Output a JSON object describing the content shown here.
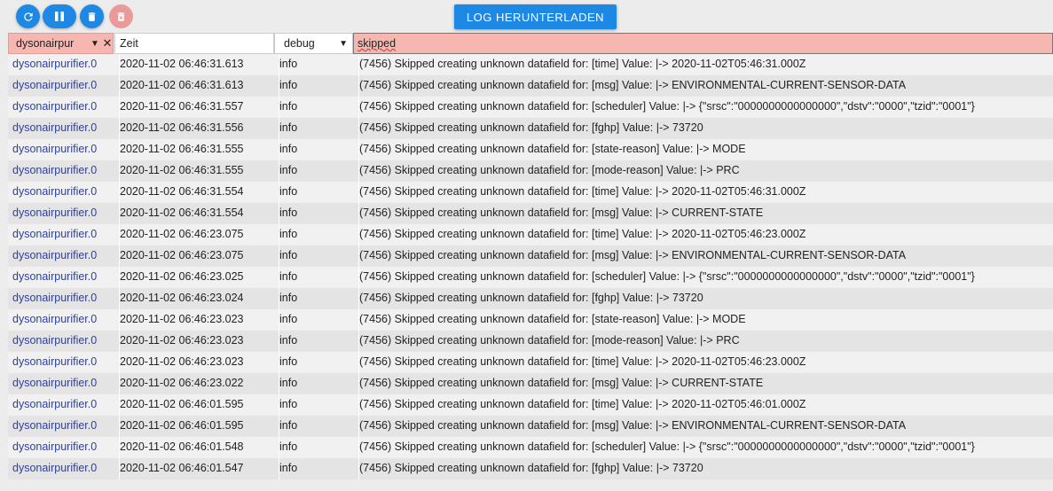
{
  "toolbar": {
    "download_label": "LOG HERUNTERLADEN",
    "buttons": [
      {
        "icon": "refresh-icon"
      },
      {
        "icon": "pause-icon"
      },
      {
        "icon": "trash-icon"
      },
      {
        "icon": "trash-x-icon",
        "disabled": true
      }
    ]
  },
  "filters": {
    "adapter_value": "dysonairpur",
    "time_placeholder": "Zeit",
    "level_value": "debug",
    "message_value": "skipped"
  },
  "rows": [
    {
      "source": "dysonairpurifier.0",
      "time": "2020-11-02 06:46:31.613",
      "level": "info",
      "message": "(7456) Skipped creating unknown datafield for: [time] Value: |-> 2020-11-02T05:46:31.000Z"
    },
    {
      "source": "dysonairpurifier.0",
      "time": "2020-11-02 06:46:31.613",
      "level": "info",
      "message": "(7456) Skipped creating unknown datafield for: [msg] Value: |-> ENVIRONMENTAL-CURRENT-SENSOR-DATA"
    },
    {
      "source": "dysonairpurifier.0",
      "time": "2020-11-02 06:46:31.557",
      "level": "info",
      "message": "(7456) Skipped creating unknown datafield for: [scheduler] Value: |-> {\"srsc\":\"0000000000000000\",\"dstv\":\"0000\",\"tzid\":\"0001\"}"
    },
    {
      "source": "dysonairpurifier.0",
      "time": "2020-11-02 06:46:31.556",
      "level": "info",
      "message": "(7456) Skipped creating unknown datafield for: [fghp] Value: |-> 73720"
    },
    {
      "source": "dysonairpurifier.0",
      "time": "2020-11-02 06:46:31.555",
      "level": "info",
      "message": "(7456) Skipped creating unknown datafield for: [state-reason] Value: |-> MODE"
    },
    {
      "source": "dysonairpurifier.0",
      "time": "2020-11-02 06:46:31.555",
      "level": "info",
      "message": "(7456) Skipped creating unknown datafield for: [mode-reason] Value: |-> PRC"
    },
    {
      "source": "dysonairpurifier.0",
      "time": "2020-11-02 06:46:31.554",
      "level": "info",
      "message": "(7456) Skipped creating unknown datafield for: [time] Value: |-> 2020-11-02T05:46:31.000Z"
    },
    {
      "source": "dysonairpurifier.0",
      "time": "2020-11-02 06:46:31.554",
      "level": "info",
      "message": "(7456) Skipped creating unknown datafield for: [msg] Value: |-> CURRENT-STATE"
    },
    {
      "source": "dysonairpurifier.0",
      "time": "2020-11-02 06:46:23.075",
      "level": "info",
      "message": "(7456) Skipped creating unknown datafield for: [time] Value: |-> 2020-11-02T05:46:23.000Z"
    },
    {
      "source": "dysonairpurifier.0",
      "time": "2020-11-02 06:46:23.075",
      "level": "info",
      "message": "(7456) Skipped creating unknown datafield for: [msg] Value: |-> ENVIRONMENTAL-CURRENT-SENSOR-DATA"
    },
    {
      "source": "dysonairpurifier.0",
      "time": "2020-11-02 06:46:23.025",
      "level": "info",
      "message": "(7456) Skipped creating unknown datafield for: [scheduler] Value: |-> {\"srsc\":\"0000000000000000\",\"dstv\":\"0000\",\"tzid\":\"0001\"}"
    },
    {
      "source": "dysonairpurifier.0",
      "time": "2020-11-02 06:46:23.024",
      "level": "info",
      "message": "(7456) Skipped creating unknown datafield for: [fghp] Value: |-> 73720"
    },
    {
      "source": "dysonairpurifier.0",
      "time": "2020-11-02 06:46:23.023",
      "level": "info",
      "message": "(7456) Skipped creating unknown datafield for: [state-reason] Value: |-> MODE"
    },
    {
      "source": "dysonairpurifier.0",
      "time": "2020-11-02 06:46:23.023",
      "level": "info",
      "message": "(7456) Skipped creating unknown datafield for: [mode-reason] Value: |-> PRC"
    },
    {
      "source": "dysonairpurifier.0",
      "time": "2020-11-02 06:46:23.023",
      "level": "info",
      "message": "(7456) Skipped creating unknown datafield for: [time] Value: |-> 2020-11-02T05:46:23.000Z"
    },
    {
      "source": "dysonairpurifier.0",
      "time": "2020-11-02 06:46:23.022",
      "level": "info",
      "message": "(7456) Skipped creating unknown datafield for: [msg] Value: |-> CURRENT-STATE"
    },
    {
      "source": "dysonairpurifier.0",
      "time": "2020-11-02 06:46:01.595",
      "level": "info",
      "message": "(7456) Skipped creating unknown datafield for: [time] Value: |-> 2020-11-02T05:46:01.000Z"
    },
    {
      "source": "dysonairpurifier.0",
      "time": "2020-11-02 06:46:01.595",
      "level": "info",
      "message": "(7456) Skipped creating unknown datafield for: [msg] Value: |-> ENVIRONMENTAL-CURRENT-SENSOR-DATA"
    },
    {
      "source": "dysonairpurifier.0",
      "time": "2020-11-02 06:46:01.548",
      "level": "info",
      "message": "(7456) Skipped creating unknown datafield for: [scheduler] Value: |-> {\"srsc\":\"0000000000000000\",\"dstv\":\"0000\",\"tzid\":\"0001\"}"
    },
    {
      "source": "dysonairpurifier.0",
      "time": "2020-11-02 06:46:01.547",
      "level": "info",
      "message": "(7456) Skipped creating unknown datafield for: [fghp] Value: |-> 73720"
    }
  ],
  "colors": {
    "accent": "#1e88e5",
    "filter_active": "#f7b6b0",
    "source_link": "#2b3fa8"
  }
}
